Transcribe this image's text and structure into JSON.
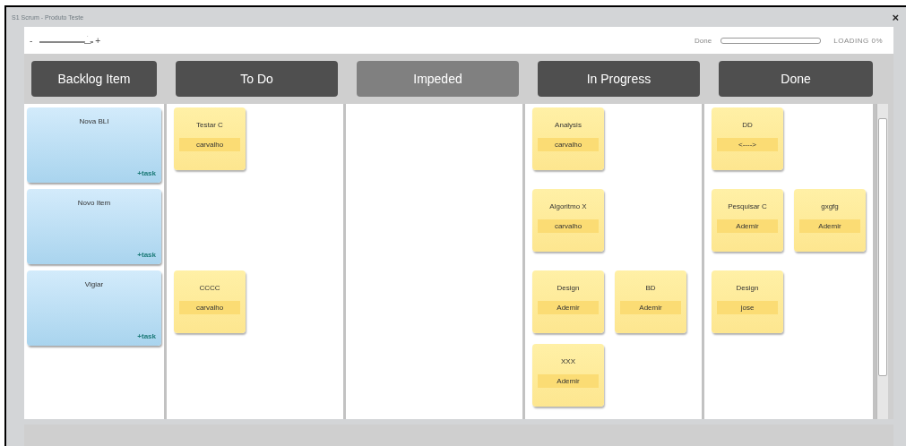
{
  "window": {
    "title": "S1 Scrum - Produto Teste",
    "close": "×"
  },
  "toolbar": {
    "zoom_out": "-",
    "zoom_in": "+",
    "zoom": {
      "level": 0.95
    },
    "progress_label": "Done",
    "progress": {
      "level": 0
    },
    "loading": "LOADING 0%"
  },
  "columns": [
    {
      "label": "Backlog Item",
      "dimmed": false
    },
    {
      "label": "To Do",
      "dimmed": false
    },
    {
      "label": "Impeded",
      "dimmed": true
    },
    {
      "label": "In Progress",
      "dimmed": false
    },
    {
      "label": "Done",
      "dimmed": false
    }
  ],
  "rows": [
    {
      "item": {
        "title": "Nova BLI",
        "link": "+task"
      },
      "cells": [
        [
          {
            "title": "Testar C",
            "assignee": "carvalho"
          }
        ],
        [],
        [
          {
            "title": "Analysis",
            "assignee": "carvalho"
          }
        ],
        [
          {
            "title": "DD",
            "assignee": "<---->"
          }
        ]
      ]
    },
    {
      "item": {
        "title": "Novo Item",
        "link": "+task"
      },
      "cells": [
        [],
        [],
        [
          {
            "title": "Algoritmo X",
            "assignee": "carvalho"
          }
        ],
        [
          {
            "title": "Pesquisar C",
            "assignee": "Ademir"
          },
          {
            "title": "gxgfg",
            "assignee": "Ademir"
          }
        ]
      ]
    },
    {
      "item": {
        "title": "Vigiar",
        "link": "+task"
      },
      "cells": [
        [
          {
            "title": "CCCC",
            "assignee": "carvalho"
          }
        ],
        [],
        [
          {
            "title": "Design",
            "assignee": "Ademir"
          },
          {
            "title": "BD",
            "assignee": "Ademir"
          },
          {
            "title": "XXX",
            "assignee": "Ademir"
          }
        ],
        [
          {
            "title": "Design",
            "assignee": "jose"
          }
        ]
      ]
    },
    {
      "item": {},
      "cells": [
        [],
        [],
        [
          {},
          {}
        ],
        []
      ]
    }
  ]
}
